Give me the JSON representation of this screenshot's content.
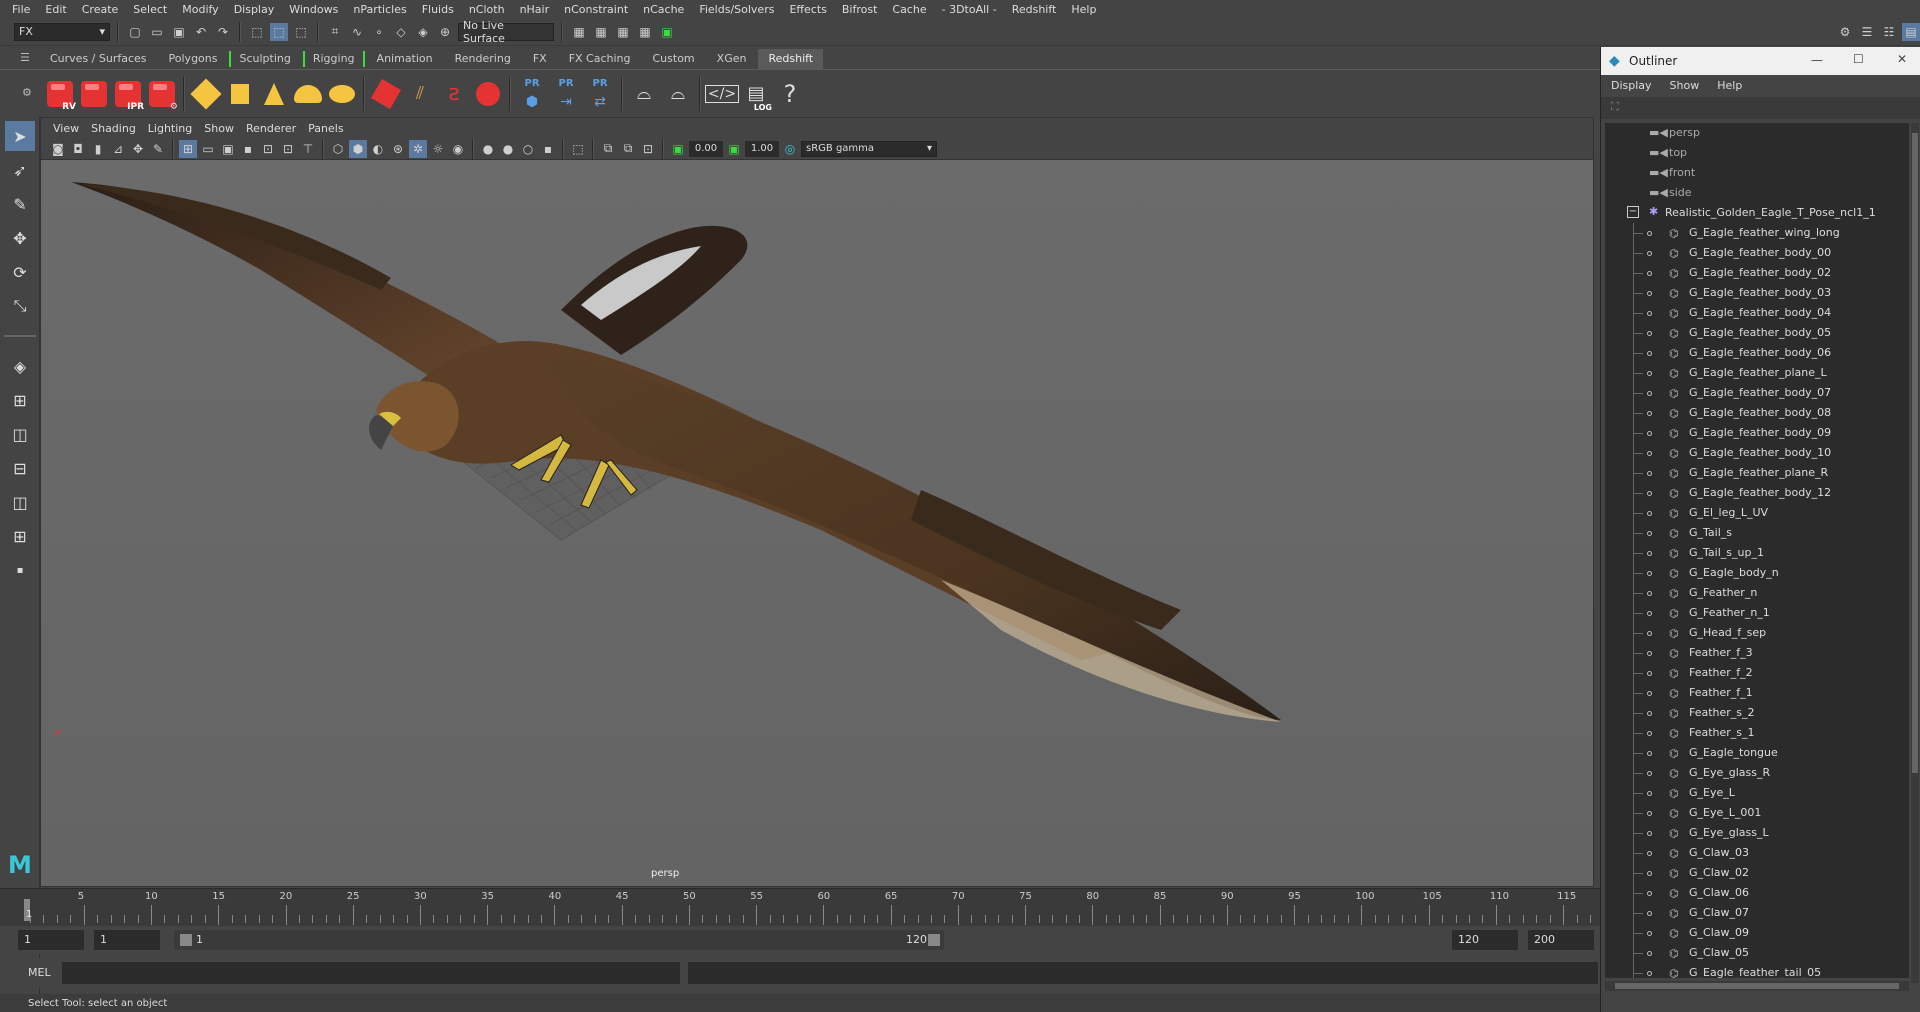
{
  "menubar": [
    "File",
    "Edit",
    "Create",
    "Select",
    "Modify",
    "Display",
    "Windows",
    "nParticles",
    "Fluids",
    "nCloth",
    "nHair",
    "nConstraint",
    "nCache",
    "Fields/Solvers",
    "Effects",
    "Bifrost",
    "Cache",
    "- 3DtoAll -",
    "Redshift",
    "Help"
  ],
  "status": {
    "menuset": "FX",
    "live_surface": "No Live Surface"
  },
  "shelf_tabs": [
    "Curves / Surfaces",
    "Polygons",
    "Sculpting",
    "Rigging",
    "Animation",
    "Rendering",
    "FX",
    "FX Caching",
    "Custom",
    "XGen",
    "Redshift"
  ],
  "shelf_active": "Redshift",
  "shelf_icons": [
    {
      "name": "render-view-icon",
      "label": "RV"
    },
    {
      "name": "render-icon",
      "label": ""
    },
    {
      "name": "ipr-icon",
      "label": "IPR"
    },
    {
      "name": "render-settings-icon",
      "label": ""
    },
    {
      "name": "pr-1-icon",
      "label": "PR"
    },
    {
      "name": "pr-2-icon",
      "label": "PR"
    },
    {
      "name": "pr-3-icon",
      "label": "PR"
    },
    {
      "name": "log-icon",
      "label": "LOG"
    },
    {
      "name": "help-icon",
      "label": "?"
    }
  ],
  "viewport": {
    "menu": [
      "View",
      "Shading",
      "Lighting",
      "Show",
      "Renderer",
      "Panels"
    ],
    "exposure": "0.00",
    "gamma": "1.00",
    "color_space": "sRGB gamma",
    "camera_label": "persp"
  },
  "timeline": {
    "ticks": [
      "5",
      "10",
      "15",
      "20",
      "25",
      "30",
      "35",
      "40",
      "45",
      "50",
      "55",
      "60",
      "65",
      "70",
      "75",
      "80",
      "85",
      "90",
      "95",
      "100",
      "105",
      "110",
      "115"
    ],
    "current": "1"
  },
  "range": {
    "start": "1",
    "start2": "1",
    "slider_start": "1",
    "slider_end": "120",
    "end": "120",
    "end2": "200"
  },
  "cmdline": {
    "label": "MEL"
  },
  "helpline": "Select Tool: select an object",
  "outliner": {
    "title": "Outliner",
    "menu": [
      "Display",
      "Show",
      "Help"
    ],
    "cameras": [
      "persp",
      "top",
      "front",
      "side"
    ],
    "group": "Realistic_Golden_Eagle_T_Pose_ncl1_1",
    "items": [
      "G_Eagle_feather_wing_long",
      "G_Eagle_feather_body_00",
      "G_Eagle_feather_body_02",
      "G_Eagle_feather_body_03",
      "G_Eagle_feather_body_04",
      "G_Eagle_feather_body_05",
      "G_Eagle_feather_body_06",
      "G_Eagle_feather_plane_L",
      "G_Eagle_feather_body_07",
      "G_Eagle_feather_body_08",
      "G_Eagle_feather_body_09",
      "G_Eagle_feather_body_10",
      "G_Eagle_feather_plane_R",
      "G_Eagle_feather_body_12",
      "G_El_leg_L_UV",
      "G_Tail_s",
      "G_Tail_s_up_1",
      "G_Eagle_body_n",
      "G_Feather_n",
      "G_Feather_n_1",
      "G_Head_f_sep",
      "Feather_f_3",
      "Feather_f_2",
      "Feather_f_1",
      "Feather_s_2",
      "Feather_s_1",
      "G_Eagle_tongue",
      "G_Eye_glass_R",
      "G_Eye_L",
      "G_Eye_L_001",
      "G_Eye_glass_L",
      "G_Claw_03",
      "G_Claw_02",
      "G_Claw_06",
      "G_Claw_07",
      "G_Claw_09",
      "G_Claw_05",
      "G_Eagle_feather_tail_05"
    ]
  },
  "colors": {
    "accent": "#3cdc3c",
    "render_red": "#e53333",
    "pr_blue": "#5aa0e6"
  }
}
